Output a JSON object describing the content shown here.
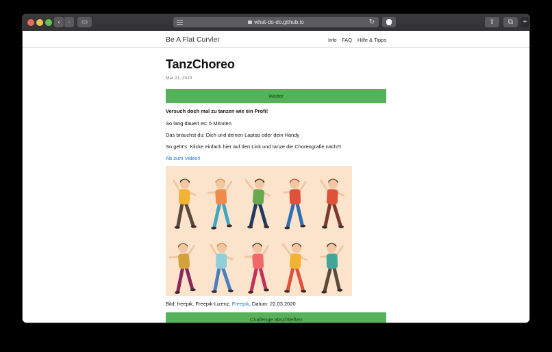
{
  "browser": {
    "url": "what-do-do.github.io",
    "traffic_lights": [
      "#ec6a5e",
      "#f4bf4f",
      "#61c554"
    ]
  },
  "site": {
    "title": "Be A Flat Curvler",
    "nav": [
      "Info",
      "FAQ",
      "Hilfe & Tipps"
    ]
  },
  "post": {
    "title": "TanzChoreo",
    "date": "Mar 21, 2020",
    "button_next": "Weiter",
    "headline": "Versuch doch mal zu tanzen wie ein Profi!",
    "duration": "So lang dauert es: 5 Minuten",
    "needs": "Das brauchst du: Dich und deinen Laptop oder dein Handy",
    "howto": "So geht's: Klicke einfach hier auf den Link und tanze die Choreografie nach!!!",
    "video_link": "Ab zum Video!!",
    "credit_prefix": "Bild: freepik, Freepik-Lizenz, ",
    "credit_link": "Freepik",
    "credit_suffix": ", Datum: 22.03.2020",
    "button_finish": "Challenge abschließen"
  },
  "illustration": {
    "background": "#fbe3cc",
    "dancers": [
      {
        "shirt": "#f2b233",
        "pants": "#5a4a3a",
        "hair": "#3a2a1c"
      },
      {
        "shirt": "#f08a4b",
        "pants": "#3fa7c4",
        "hair": "#e0902f"
      },
      {
        "shirt": "#6aa84f",
        "pants": "#223a5e",
        "hair": "#3a2a1c"
      },
      {
        "shirt": "#e0513c",
        "pants": "#2f6fb0",
        "hair": "#c2452b"
      },
      {
        "shirt": "#e0513c",
        "pants": "#7a3a2c",
        "hair": "#6b3a1c"
      },
      {
        "shirt": "#d4a23a",
        "pants": "#8a2a5a",
        "hair": "#8a5a2c"
      },
      {
        "shirt": "#8fd0d8",
        "pants": "#4a7fc0",
        "hair": "#d0902f"
      },
      {
        "shirt": "#f06a6a",
        "pants": "#c2305a",
        "hair": "#4a2a1c"
      },
      {
        "shirt": "#f2b233",
        "pants": "#e0513c",
        "hair": "#6b3a1c"
      },
      {
        "shirt": "#3fa79a",
        "pants": "#5a4a3a",
        "hair": "#3a2a1c"
      }
    ]
  }
}
